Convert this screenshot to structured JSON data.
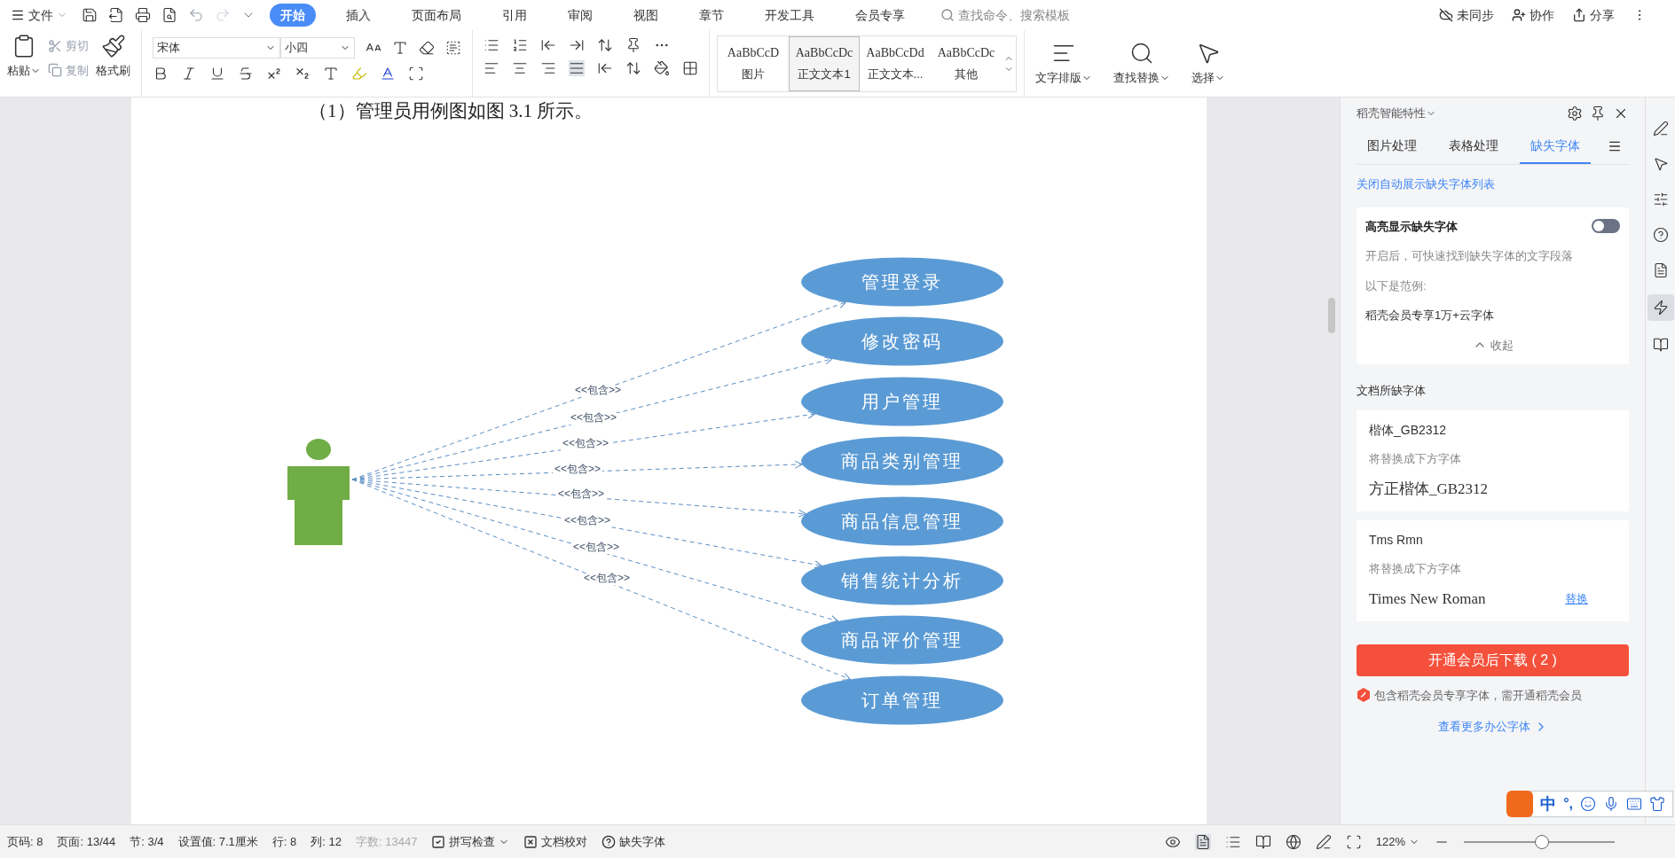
{
  "menu_bar": {
    "file": "文件",
    "tabs": [
      {
        "label": "开始",
        "selected": true
      },
      {
        "label": "插入",
        "selected": false
      },
      {
        "label": "页面布局",
        "selected": false
      },
      {
        "label": "引用",
        "selected": false
      },
      {
        "label": "审阅",
        "selected": false
      },
      {
        "label": "视图",
        "selected": false
      },
      {
        "label": "章节",
        "selected": false
      },
      {
        "label": "开发工具",
        "selected": false
      },
      {
        "label": "会员专享",
        "selected": false
      }
    ],
    "search": {
      "placeholder": "查找命令、搜索模板"
    },
    "actions": [
      "未同步",
      "协作",
      "分享"
    ]
  },
  "ribbon": {
    "clipboard": [
      {
        "label": "粘贴",
        "disabled": false
      },
      {
        "label": "剪切",
        "disabled": true
      },
      {
        "label": "复制",
        "disabled": true
      },
      {
        "label": "格式刷",
        "disabled": false
      }
    ],
    "font": "宋体",
    "size": "小四",
    "styles": [
      {
        "preview": "AaBbCcD",
        "label": "图片",
        "selected": false
      },
      {
        "preview": "AaBbCcDc",
        "label": "正文文本1",
        "selected": true
      },
      {
        "preview": "AaBbCcDd",
        "label": "正文文本...",
        "selected": false
      },
      {
        "preview": "AaBbCcDc",
        "label": "其他",
        "selected": false
      }
    ],
    "tools": [
      "文字排版",
      "查找替换",
      "选择"
    ]
  },
  "document": {
    "paragraph": "（1）管理员用例图如图 3.1 所示。",
    "use_cases": [
      {
        "label": "管理登录",
        "relation": "<<包含>>"
      },
      {
        "label": "修改密码",
        "relation": "<<包含>>"
      },
      {
        "label": "用户管理",
        "relation": "<<包含>>"
      },
      {
        "label": "商品类别管理",
        "relation": "<<包含>>"
      },
      {
        "label": "商品信息管理",
        "relation": "<<包含>>"
      },
      {
        "label": "销售统计分析",
        "relation": "<<包含>>"
      },
      {
        "label": "商品评价管理",
        "relation": "<<包含>>"
      },
      {
        "label": "订单管理",
        "relation": "<<包含>>"
      }
    ]
  },
  "side_panel": {
    "title": "稻壳智能特性",
    "tabs": [
      {
        "label": "图片处理",
        "selected": false
      },
      {
        "label": "表格处理",
        "selected": false
      },
      {
        "label": "缺失字体",
        "selected": true
      }
    ],
    "link": "关闭自动展示缺失字体列表",
    "highlight_card": {
      "title": "高亮显示缺失字体",
      "on": false,
      "description": "开启后，可快速找到缺失字体的文字段落",
      "example_caption": "以下是范例:",
      "example": "稻壳会员专享1万+云字体",
      "collapse": "收起"
    },
    "section_title": "文档所缺字体",
    "fonts": [
      {
        "missing": "楷体_GB2312",
        "note": "将替换成下方字体",
        "replacement": "方正楷体_GB2312"
      },
      {
        "missing": "Tms Rmn",
        "note": "将替换成下方字体",
        "replacement": "Times New Roman",
        "action": "替换"
      }
    ],
    "download_button": "开通会员后下载 ( 2 )",
    "member_note": "包含稻壳会员专享字体，需开通稻壳会员",
    "more_link": "查看更多办公字体"
  },
  "ime_bar": {
    "mode": "中",
    "punctuation": "°,"
  },
  "status_bar": {
    "items": [
      {
        "label": "页码: 8",
        "disabled": false
      },
      {
        "label": "页面: 13/44",
        "disabled": false
      },
      {
        "label": "节: 3/4",
        "disabled": false
      },
      {
        "label": "设置值: 7.1厘米",
        "disabled": false
      },
      {
        "label": "行: 8",
        "disabled": false
      },
      {
        "label": "列: 12",
        "disabled": false
      },
      {
        "label": "字数: 13447",
        "disabled": true
      }
    ],
    "tools": [
      "拼写检查",
      "文档校对",
      "缺失字体"
    ],
    "zoom": "122%",
    "zoom_level": {
      "level": 0.52
    }
  }
}
